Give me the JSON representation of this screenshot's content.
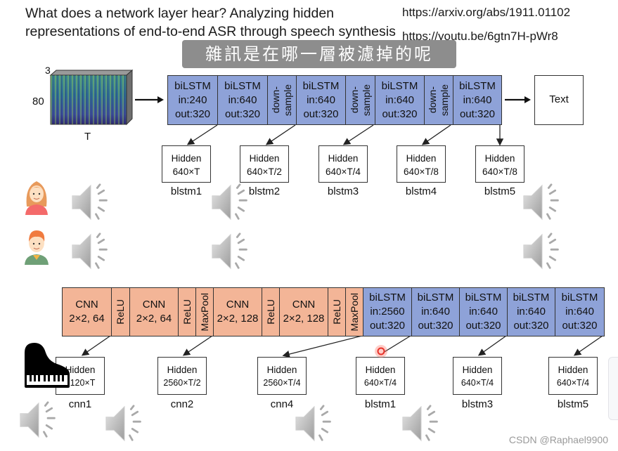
{
  "slide": {
    "title": "What does a network layer hear? Analyzing hidden representations of end-to-end ASR through speech synthesis",
    "links": [
      "https://arxiv.org/abs/1911.01102",
      "https://youtu.be/6gtn7H-pWr8"
    ],
    "subtitle_caption": "雜訊是在哪一層被濾掉的呢",
    "watermark": "CSDN @Raphael9900"
  },
  "top_model": {
    "input": {
      "channels": "3",
      "freq": "80",
      "time": "T"
    },
    "output": "Text",
    "blocks": [
      {
        "type": "bilstm",
        "lines": [
          "biLSTM",
          "in:240",
          "out:320"
        ]
      },
      {
        "type": "bilstm",
        "lines": [
          "biLSTM",
          "in:640",
          "out:320"
        ]
      },
      {
        "type": "downsample",
        "lines": [
          "down-",
          "sample"
        ]
      },
      {
        "type": "bilstm",
        "lines": [
          "biLSTM",
          "in:640",
          "out:320"
        ]
      },
      {
        "type": "downsample",
        "lines": [
          "down-",
          "sample"
        ]
      },
      {
        "type": "bilstm",
        "lines": [
          "biLSTM",
          "in:640",
          "out:320"
        ]
      },
      {
        "type": "downsample",
        "lines": [
          "down-",
          "sample"
        ]
      },
      {
        "type": "bilstm",
        "lines": [
          "biLSTM",
          "in:640",
          "out:320"
        ]
      }
    ],
    "hidden": [
      {
        "title": "Hidden",
        "dims": "640×T",
        "label": "blstm1"
      },
      {
        "title": "Hidden",
        "dims": "640×T/2",
        "label": "blstm2"
      },
      {
        "title": "Hidden",
        "dims": "640×T/4",
        "label": "blstm3"
      },
      {
        "title": "Hidden",
        "dims": "640×T/8",
        "label": "blstm4"
      },
      {
        "title": "Hidden",
        "dims": "640×T/8",
        "label": "blstm5"
      }
    ]
  },
  "speakers": [
    {
      "name": "female-speaker",
      "audio_clips": 3
    },
    {
      "name": "male-speaker",
      "audio_clips": 3
    }
  ],
  "bottom_model": {
    "blocks": [
      {
        "type": "cnn",
        "lines": [
          "CNN",
          "2×2, 64"
        ]
      },
      {
        "type": "relu",
        "lines": [
          "ReLU"
        ]
      },
      {
        "type": "cnn",
        "lines": [
          "CNN",
          "2×2, 64"
        ]
      },
      {
        "type": "relu",
        "lines": [
          "ReLU"
        ]
      },
      {
        "type": "maxpool",
        "lines": [
          "MaxPool"
        ]
      },
      {
        "type": "cnn",
        "lines": [
          "CNN",
          "2×2, 128"
        ]
      },
      {
        "type": "relu",
        "lines": [
          "ReLU"
        ]
      },
      {
        "type": "cnn",
        "lines": [
          "CNN",
          "2×2, 128"
        ]
      },
      {
        "type": "relu",
        "lines": [
          "ReLU"
        ]
      },
      {
        "type": "maxpool",
        "lines": [
          "MaxPool"
        ]
      },
      {
        "type": "bilstm",
        "lines": [
          "biLSTM",
          "in:2560",
          "out:320"
        ]
      },
      {
        "type": "bilstm",
        "lines": [
          "biLSTM",
          "in:640",
          "out:320"
        ]
      },
      {
        "type": "bilstm",
        "lines": [
          "biLSTM",
          "in:640",
          "out:320"
        ]
      },
      {
        "type": "bilstm",
        "lines": [
          "biLSTM",
          "in:640",
          "out:320"
        ]
      },
      {
        "type": "bilstm",
        "lines": [
          "biLSTM",
          "in:640",
          "out:320"
        ]
      }
    ],
    "hidden": [
      {
        "title": "Hidden",
        "dims": "5120×T",
        "label": "cnn1"
      },
      {
        "title": "Hidden",
        "dims": "2560×T/2",
        "label": "cnn2"
      },
      {
        "title": "Hidden",
        "dims": "2560×T/4",
        "label": "cnn4"
      },
      {
        "title": "Hidden",
        "dims": "640×T/4",
        "label": "blstm1"
      },
      {
        "title": "Hidden",
        "dims": "640×T/4",
        "label": "blstm3"
      },
      {
        "title": "Hidden",
        "dims": "640×T/4",
        "label": "blstm5"
      }
    ],
    "noise_source": "piano-icon"
  },
  "colors": {
    "lstm_blue": "#8ea2d8",
    "cnn_orange": "#f3b597",
    "caption_bg": "#8d8d8d",
    "cursor_red": "#e8332a"
  }
}
